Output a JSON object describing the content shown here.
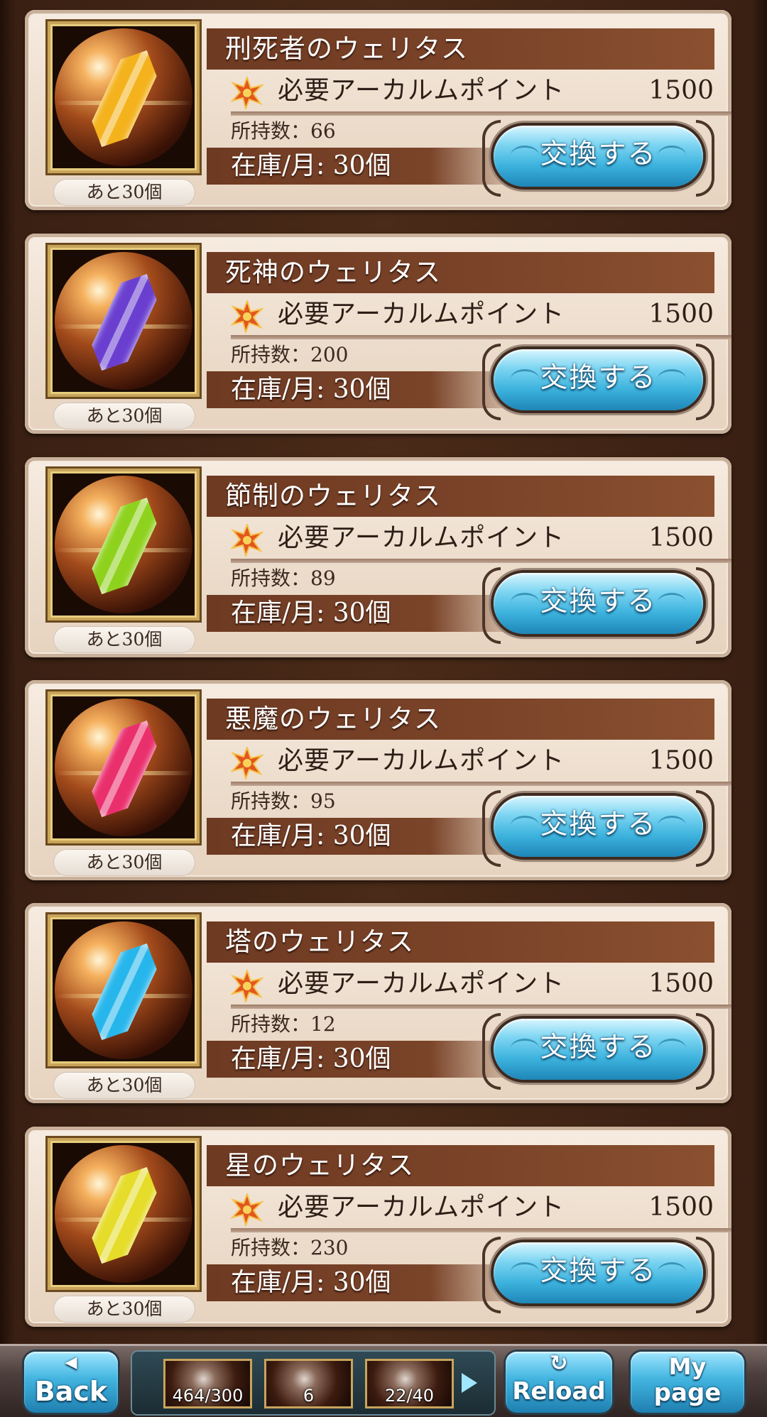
{
  "cost_label": "必要アーカルムポイント",
  "owned_prefix": "所持数：",
  "exchange_label": "交換する",
  "items": [
    {
      "name": "刑死者のウェリタス",
      "cost": "1500",
      "owned": "66",
      "stock": "在庫/月: 30個",
      "remaining": "あと30個",
      "crystal_color": "#f4b21c"
    },
    {
      "name": "死神のウェリタス",
      "cost": "1500",
      "owned": "200",
      "stock": "在庫/月: 30個",
      "remaining": "あと30個",
      "crystal_color": "#6a3fd0"
    },
    {
      "name": "節制のウェリタス",
      "cost": "1500",
      "owned": "89",
      "stock": "在庫/月: 30個",
      "remaining": "あと30個",
      "crystal_color": "#8fd21e"
    },
    {
      "name": "悪魔のウェリタス",
      "cost": "1500",
      "owned": "95",
      "stock": "在庫/月: 30個",
      "remaining": "あと30個",
      "crystal_color": "#ea2f6d"
    },
    {
      "name": "塔のウェリタス",
      "cost": "1500",
      "owned": "12",
      "stock": "在庫/月: 30個",
      "remaining": "あと30個",
      "crystal_color": "#27b6ec"
    },
    {
      "name": "星のウェリタス",
      "cost": "1500",
      "owned": "230",
      "stock": "在庫/月: 30個",
      "remaining": "あと30個",
      "crystal_color": "#e6dc2a"
    }
  ],
  "bottom_bar": {
    "back_label_top": "◀",
    "back_label": "Back",
    "counters": [
      {
        "value": "464/300"
      },
      {
        "value": "6"
      },
      {
        "value": "22/40"
      }
    ],
    "reload_icon": "↻",
    "reload_label": "Reload",
    "mypage_label_top": "My",
    "mypage_label": "page"
  },
  "colors": {
    "name_bar": "#7b4429",
    "button_blue": "#3db3de",
    "frame_gold": "#c8a35a"
  }
}
